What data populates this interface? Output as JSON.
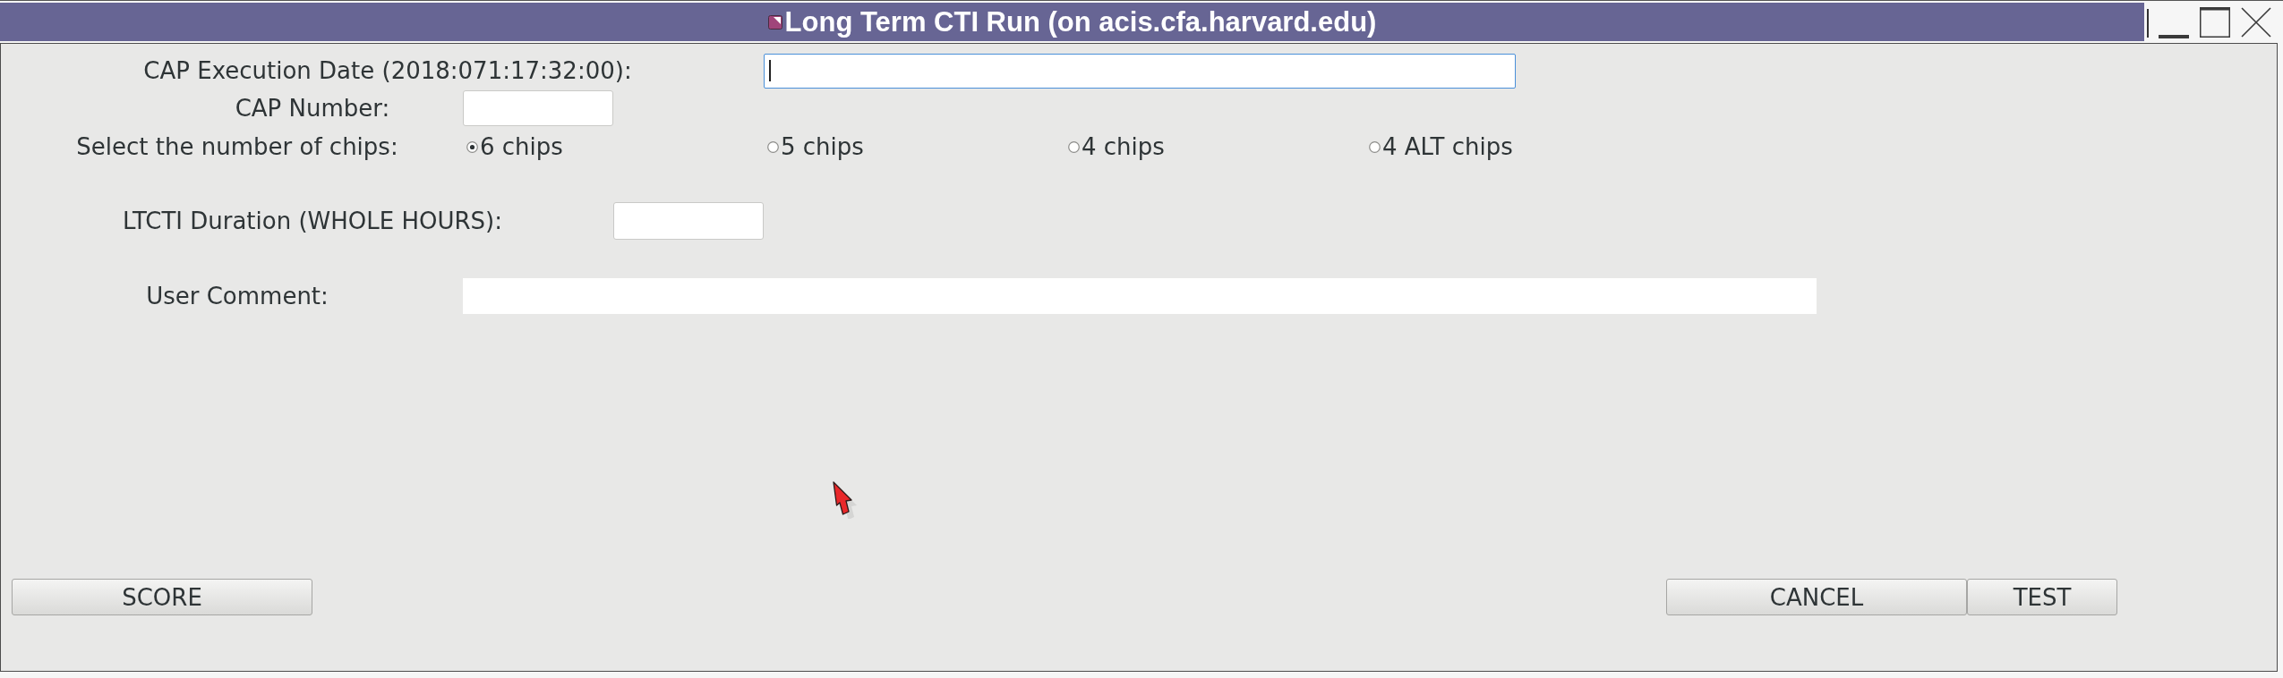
{
  "window": {
    "title": "Long Term CTI Run (on acis.cfa.harvard.edu)"
  },
  "execution_date": {
    "label": "CAP Execution Date (2018:071:17:32:00):",
    "focused": true
  },
  "cap_number": {
    "label": "CAP Number:"
  },
  "chips": {
    "label": "Select the number of chips:",
    "options": [
      {
        "label": "6 chips",
        "selected": true
      },
      {
        "label": "5 chips",
        "selected": false
      },
      {
        "label": "4 chips",
        "selected": false
      },
      {
        "label": "4 ALT chips",
        "selected": false
      }
    ]
  },
  "duration": {
    "label": "LTCTI Duration (WHOLE HOURS):"
  },
  "comment": {
    "label": "User Comment:"
  },
  "buttons": {
    "left": [
      "SCORE"
    ],
    "right": [
      "CANCEL",
      "TEST"
    ]
  }
}
